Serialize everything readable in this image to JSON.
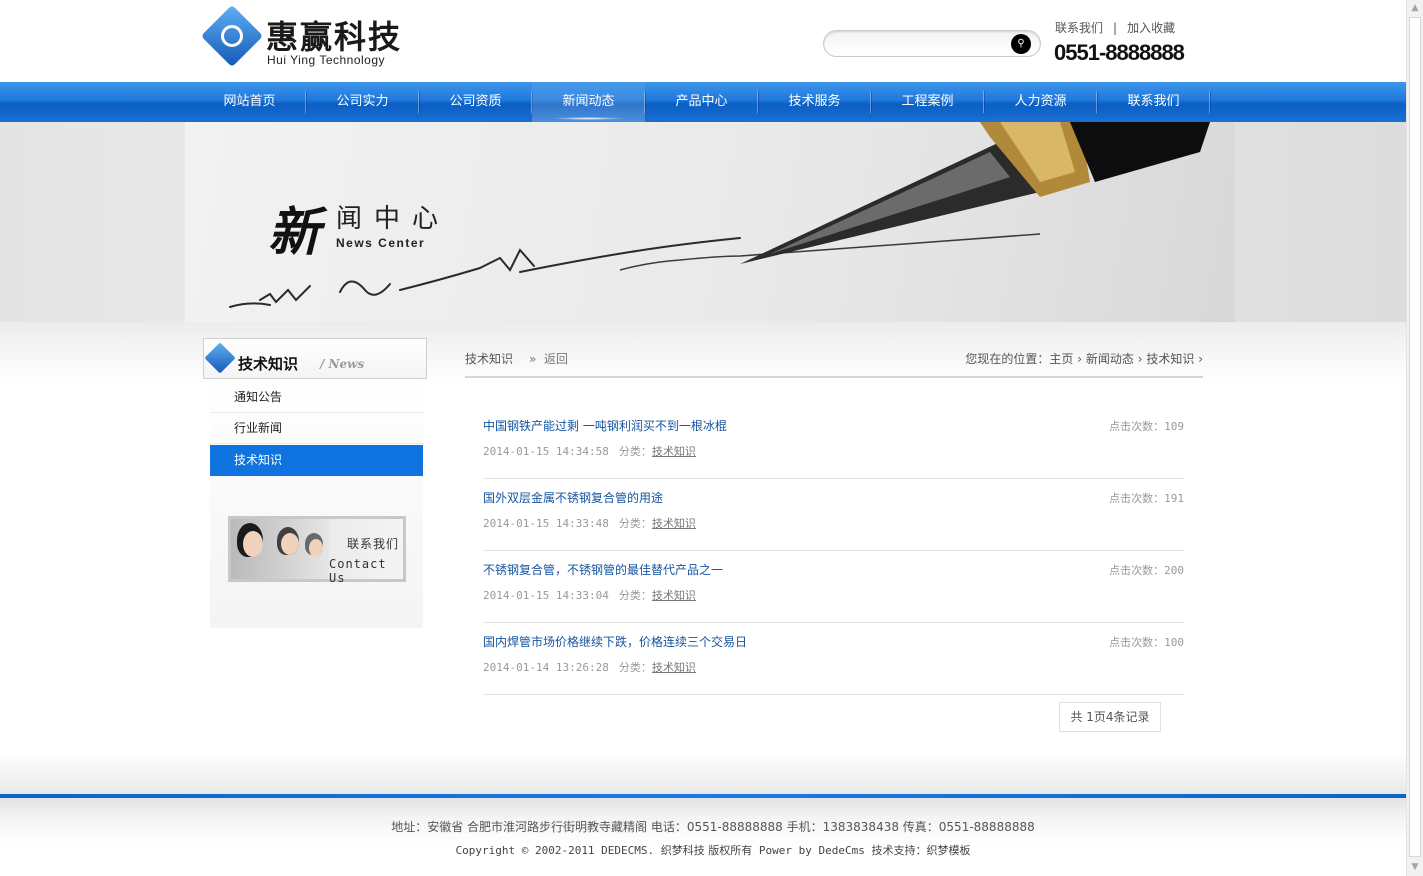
{
  "header": {
    "logo_cn": "惠赢科技",
    "logo_en": "Hui Ying Technology",
    "search_placeholder": "",
    "top_links": [
      "联系我们",
      "加入收藏"
    ],
    "top_links_separator": "|",
    "phone": "0551-8888888"
  },
  "nav": {
    "items": [
      "网站首页",
      "公司实力",
      "公司资质",
      "新闻动态",
      "产品中心",
      "技术服务",
      "工程案例",
      "人力资源",
      "联系我们"
    ],
    "active_index": 3
  },
  "banner": {
    "title_first": "新",
    "title_rest": "闻中心",
    "title_en": "News Center"
  },
  "sidebar": {
    "heading": "技术知识",
    "heading_en": "/ News",
    "items": [
      "通知公告",
      "行业新闻",
      "技术知识"
    ],
    "active_index": 2,
    "contact_cn": "联系我们",
    "contact_en": "Contact Us"
  },
  "main": {
    "category": "技术知识",
    "back": "返回",
    "location_prefix": "您现在的位置：",
    "breadcrumb": [
      "主页",
      "新闻动态",
      "技术知识"
    ],
    "hits_label": "点击次数：",
    "category_label": "分类：",
    "news": [
      {
        "title": "中国钢铁产能过剩 一吨钢利润买不到一根冰棍",
        "hits": "109",
        "date": "2014-01-15 14:34:58",
        "category": "技术知识"
      },
      {
        "title": "国外双层金属不锈钢复合管的用途",
        "hits": "191",
        "date": "2014-01-15 14:33:48",
        "category": "技术知识"
      },
      {
        "title": "不锈钢复合管，不锈钢管的最佳替代产品之一",
        "hits": "200",
        "date": "2014-01-15 14:33:04",
        "category": "技术知识"
      },
      {
        "title": "国内焊管市场价格继续下跌，价格连续三个交易日",
        "hits": "100",
        "date": "2014-01-14 13:26:28",
        "category": "技术知识"
      }
    ],
    "pager": "共 1页4条记录"
  },
  "footer": {
    "line1": "地址：安徽省 合肥市淮河路步行街明教寺藏精阁 电话：0551-88888888 手机：1383838438 传真：0551-88888888",
    "line2_a": "Copyright © 2002-2011 DEDECMS.",
    "line2_b": "织梦科技 版权所有",
    "line2_c": "Power by DedeCms",
    "line2_d": "技术支持：织梦模板"
  },
  "colors": {
    "nav_blue": "#1f79dc",
    "active_side": "#0f74e0",
    "news_title": "#1655a0"
  }
}
